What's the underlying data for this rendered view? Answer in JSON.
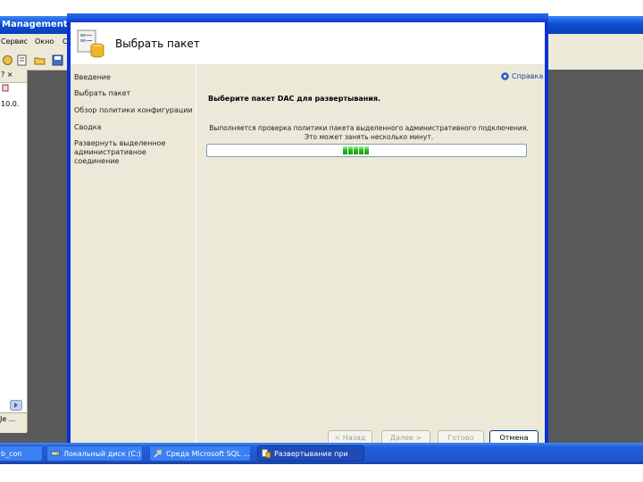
{
  "background_app": {
    "title": "Management Stu",
    "menu": [
      "Сервис",
      "Окно",
      "С"
    ],
    "left_panel": {
      "header_text": "? ×",
      "item_text": "10.0.",
      "bottom_text": "Je ..."
    }
  },
  "dialog": {
    "header_title": "Выбрать пакет",
    "nav_items": [
      "Введение",
      "Выбрать пакет",
      "Обзор политики конфигурации",
      "Сводка",
      "Развернуть выделенное административное соединение"
    ],
    "help_label": "Справка",
    "section_title": "Выберите пакет DAC для развертывания.",
    "progress_message_line1": "Выполняется проверка политики пакета выделенного административного подключения.",
    "progress_message_line2": "Это может занять несколько минут.",
    "progress_blocks": 5,
    "buttons": {
      "back": "< Назад",
      "next": "Далее >",
      "finish": "Готово",
      "cancel": "Отмена"
    }
  },
  "taskbar": {
    "items": [
      {
        "label": "b_con",
        "icon": "window-icon"
      },
      {
        "label": "Локальный диск (C:)",
        "icon": "drive-icon"
      },
      {
        "label": "Среда Microsoft SQL ...",
        "icon": "sql-tools-icon"
      },
      {
        "label": "Развертывание при",
        "icon": "package-icon",
        "active": true
      }
    ]
  },
  "colors": {
    "dialog_border": "#0831d9",
    "panel_bg": "#ece9d8",
    "progress_green": "#2bb520",
    "taskbar_blue": "#245edb"
  }
}
